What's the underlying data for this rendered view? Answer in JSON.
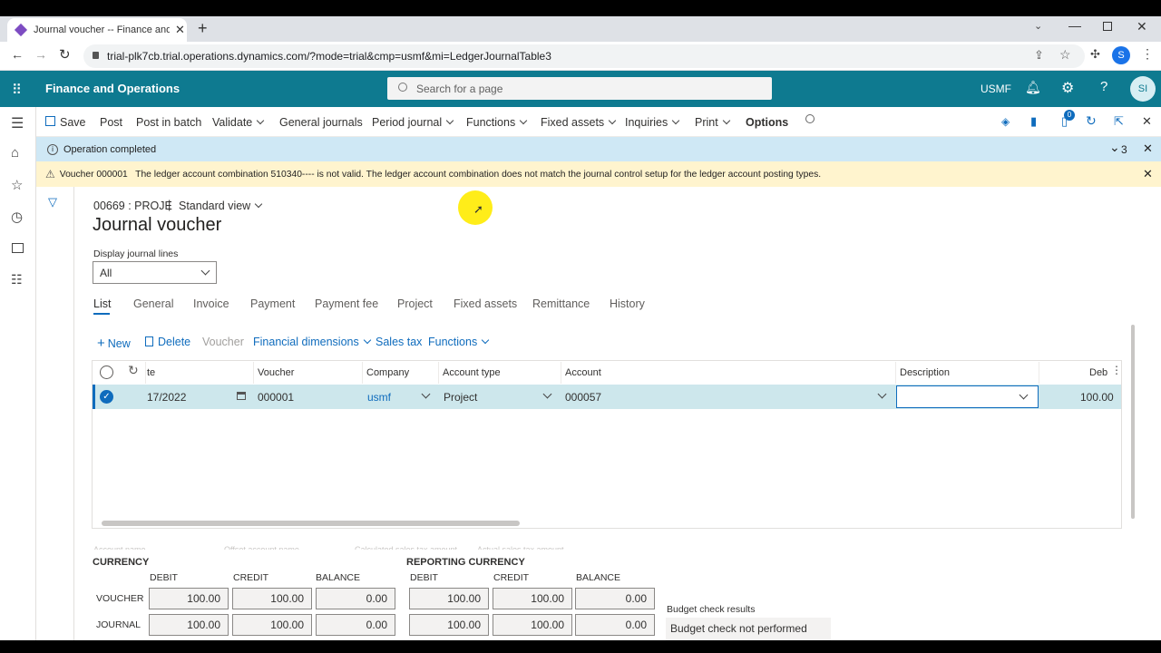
{
  "browser": {
    "tab_title": "Journal voucher -- Finance and O",
    "url": "trial-plk7cb.trial.operations.dynamics.com/?mode=trial&cmp=usmf&mi=LedgerJournalTable3",
    "profile_initial": "S"
  },
  "app": {
    "title": "Finance and Operations",
    "search_placeholder": "Search for a page",
    "company": "USMF",
    "user_initials": "SI"
  },
  "action_pane": {
    "items": [
      "Save",
      "Post",
      "Post in batch",
      "Validate",
      "General journals",
      "Period journal",
      "Functions",
      "Fixed assets",
      "Inquiries",
      "Print",
      "Options"
    ],
    "badge_count": "0"
  },
  "messages": {
    "operation": "Operation completed",
    "count": "3",
    "warning": "Voucher 000001   The ledger account combination 510340---- is not valid. The ledger account combination does not match the journal control setup for the ledger account posting types."
  },
  "page": {
    "breadcrumb": "00669 : PROJE",
    "view": "Standard view",
    "title": "Journal voucher",
    "display_label": "Display journal lines",
    "display_value": "All",
    "tabs": [
      "List",
      "General",
      "Invoice",
      "Payment",
      "Payment fee",
      "Project",
      "Fixed assets",
      "Remittance",
      "History"
    ],
    "grid_actions": [
      "New",
      "Delete",
      "Voucher",
      "Financial dimensions",
      "Sales tax",
      "Functions"
    ]
  },
  "grid": {
    "columns": [
      "te",
      "Voucher",
      "Company",
      "Account type",
      "Account",
      "Description",
      "Deb"
    ],
    "row": {
      "date": "17/2022",
      "voucher": "000001",
      "company": "usmf",
      "account_type": "Project",
      "account": "000057",
      "description": "",
      "debit": "100.00"
    },
    "footer_hidden_labels": [
      "Account name",
      "Offset account name",
      "Calculated sales tax amount",
      "Actual sales tax amount"
    ]
  },
  "totals": {
    "currency_title": "CURRENCY",
    "reporting_title": "REPORTING CURRENCY",
    "col_labels": [
      "DEBIT",
      "CREDIT",
      "BALANCE"
    ],
    "row_labels": [
      "VOUCHER",
      "JOURNAL"
    ],
    "currency": {
      "voucher": [
        "100.00",
        "100.00",
        "0.00"
      ],
      "journal": [
        "100.00",
        "100.00",
        "0.00"
      ]
    },
    "reporting": {
      "voucher": [
        "100.00",
        "100.00",
        "0.00"
      ],
      "journal": [
        "100.00",
        "100.00",
        "0.00"
      ]
    },
    "budget_label": "Budget check results",
    "budget_value": "Budget check not performed"
  },
  "colors": {
    "header": "#0e7a90",
    "accent": "#0f6cbd",
    "warning_bg": "#fff4ce",
    "info_bg": "#cfe8f5",
    "selected_row": "#cde7ec"
  }
}
